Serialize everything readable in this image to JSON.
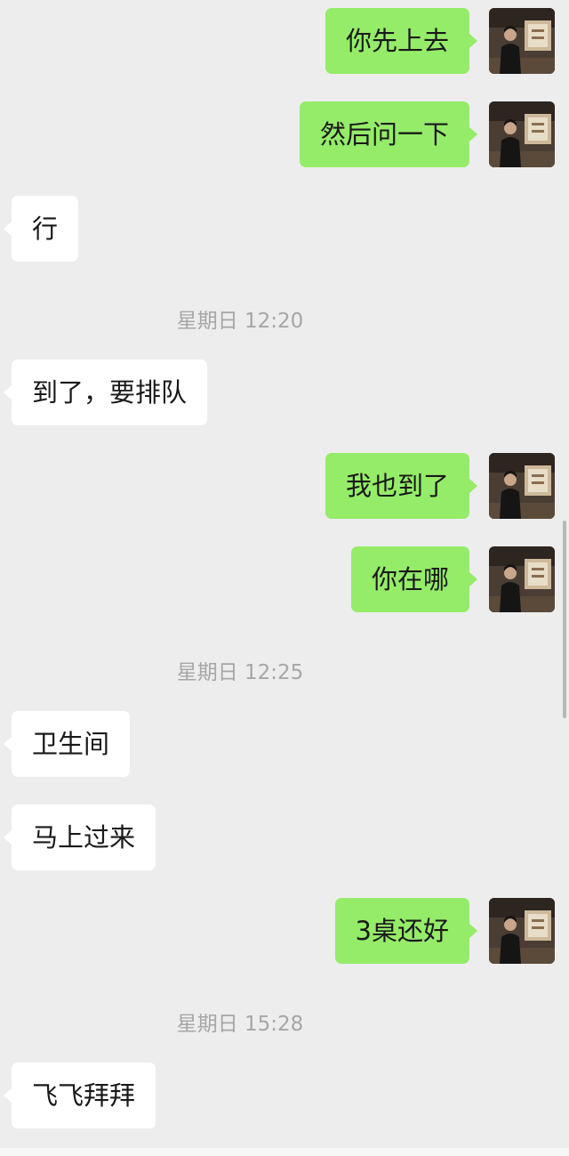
{
  "messages": [
    {
      "side": "out",
      "text": "你先上去"
    },
    {
      "side": "out",
      "text": "然后问一下"
    },
    {
      "side": "in",
      "text": "行"
    },
    {
      "type": "time",
      "text": "星期日 12:20"
    },
    {
      "side": "in",
      "text": "到了，要排队"
    },
    {
      "side": "out",
      "text": "我也到了"
    },
    {
      "side": "out",
      "text": "你在哪"
    },
    {
      "type": "time",
      "text": "星期日 12:25"
    },
    {
      "side": "in",
      "text": "卫生间"
    },
    {
      "side": "in",
      "text": "马上过来"
    },
    {
      "side": "out",
      "text": "3桌还好"
    },
    {
      "type": "time",
      "text": "星期日 15:28"
    },
    {
      "side": "in",
      "text": "飞飞拜拜"
    }
  ],
  "colors": {
    "background": "#ededed",
    "outgoing_bubble": "#95ec69",
    "incoming_bubble": "#ffffff",
    "timestamp_text": "#a6a6a6"
  },
  "icons": {
    "avatar": "user-avatar-photo"
  }
}
